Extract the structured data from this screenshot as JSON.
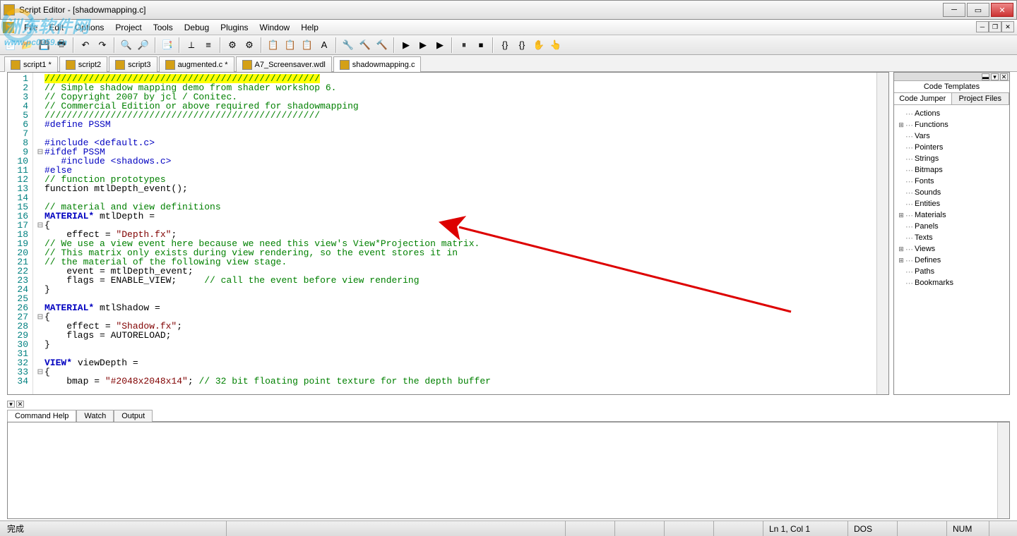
{
  "window": {
    "title": "Script Editor - [shadowmapping.c]"
  },
  "menu": [
    "File",
    "Edit",
    "Options",
    "Project",
    "Tools",
    "Debug",
    "Plugins",
    "Window",
    "Help"
  ],
  "tabs": [
    {
      "label": "script1 *"
    },
    {
      "label": "script2"
    },
    {
      "label": "script3"
    },
    {
      "label": "augmented.c *"
    },
    {
      "label": "A7_Screensaver.wdl"
    },
    {
      "label": "shadowmapping.c",
      "active": true
    }
  ],
  "code": [
    {
      "n": 1,
      "fold": "",
      "cls": "hl-yellow c-comment",
      "text": "//////////////////////////////////////////////////"
    },
    {
      "n": 2,
      "fold": "",
      "cls": "c-comment",
      "text": "// Simple shadow mapping demo from shader workshop 6."
    },
    {
      "n": 3,
      "fold": "",
      "cls": "c-comment",
      "text": "// Copyright 2007 by jcl / Conitec."
    },
    {
      "n": 4,
      "fold": "",
      "cls": "c-comment",
      "text": "// Commercial Edition or above required for shadowmapping"
    },
    {
      "n": 5,
      "fold": "",
      "cls": "c-comment",
      "text": "//////////////////////////////////////////////////"
    },
    {
      "n": 6,
      "fold": "",
      "cls": "c-preproc",
      "text": "#define PSSM"
    },
    {
      "n": 7,
      "fold": "",
      "cls": "",
      "text": ""
    },
    {
      "n": 8,
      "fold": "",
      "cls": "c-preproc",
      "text": "#include <default.c>"
    },
    {
      "n": 9,
      "fold": "⊟",
      "cls": "c-preproc",
      "text": "#ifdef PSSM"
    },
    {
      "n": 10,
      "fold": "",
      "cls": "c-preproc",
      "text": "   #include <shadows.c>"
    },
    {
      "n": 11,
      "fold": "",
      "cls": "c-preproc",
      "text": "#else"
    },
    {
      "n": 12,
      "fold": "",
      "cls": "c-comment",
      "text": "// function prototypes"
    },
    {
      "n": 13,
      "fold": "",
      "cls": "c-ident",
      "text": "function mtlDepth_event();"
    },
    {
      "n": 14,
      "fold": "",
      "cls": "",
      "text": ""
    },
    {
      "n": 15,
      "fold": "",
      "cls": "c-comment",
      "text": "// material and view definitions"
    },
    {
      "n": 16,
      "fold": "",
      "cls": "c-ident",
      "html": "<span class='c-keyword'>MATERIAL*</span> mtlDepth ="
    },
    {
      "n": 17,
      "fold": "⊟",
      "cls": "c-ident",
      "text": "{"
    },
    {
      "n": 18,
      "fold": "",
      "cls": "c-ident",
      "html": "    effect = <span class='c-string'>\"Depth.fx\"</span>;"
    },
    {
      "n": 19,
      "fold": "",
      "cls": "c-comment",
      "text": "// We use a view event here because we need this view's View*Projection matrix."
    },
    {
      "n": 20,
      "fold": "",
      "cls": "c-comment",
      "text": "// This matrix only exists during view rendering, so the event stores it in"
    },
    {
      "n": 21,
      "fold": "",
      "cls": "c-comment",
      "text": "// the material of the following view stage."
    },
    {
      "n": 22,
      "fold": "",
      "cls": "c-ident",
      "text": "    event = mtlDepth_event;"
    },
    {
      "n": 23,
      "fold": "",
      "cls": "c-ident",
      "html": "    flags = ENABLE_VIEW;     <span class='c-comment'>// call the event before view rendering</span>"
    },
    {
      "n": 24,
      "fold": "",
      "cls": "c-ident",
      "text": "}"
    },
    {
      "n": 25,
      "fold": "",
      "cls": "",
      "text": ""
    },
    {
      "n": 26,
      "fold": "",
      "cls": "c-ident",
      "html": "<span class='c-keyword'>MATERIAL*</span> mtlShadow ="
    },
    {
      "n": 27,
      "fold": "⊟",
      "cls": "c-ident",
      "text": "{"
    },
    {
      "n": 28,
      "fold": "",
      "cls": "c-ident",
      "html": "    effect = <span class='c-string'>\"Shadow.fx\"</span>;"
    },
    {
      "n": 29,
      "fold": "",
      "cls": "c-ident",
      "text": "    flags = AUTORELOAD;"
    },
    {
      "n": 30,
      "fold": "",
      "cls": "c-ident",
      "text": "}"
    },
    {
      "n": 31,
      "fold": "",
      "cls": "",
      "text": ""
    },
    {
      "n": 32,
      "fold": "",
      "cls": "c-ident",
      "html": "<span class='c-keyword'>VIEW*</span> viewDepth ="
    },
    {
      "n": 33,
      "fold": "⊟",
      "cls": "c-ident",
      "text": "{"
    },
    {
      "n": 34,
      "fold": "",
      "cls": "c-ident",
      "html": "    bmap = <span class='c-string'>\"#2048x2048x14\"</span>; <span class='c-comment'>// 32 bit floating point texture for the depth buffer</span>"
    }
  ],
  "sidebar": {
    "tab_top": "Code Templates",
    "tabs_bot": [
      "Code Jumper",
      "Project Files"
    ],
    "tree": [
      {
        "exp": "",
        "label": "Actions"
      },
      {
        "exp": "+",
        "label": "Functions"
      },
      {
        "exp": "",
        "label": "Vars"
      },
      {
        "exp": "",
        "label": "Pointers"
      },
      {
        "exp": "",
        "label": "Strings"
      },
      {
        "exp": "",
        "label": "Bitmaps"
      },
      {
        "exp": "",
        "label": "Fonts"
      },
      {
        "exp": "",
        "label": "Sounds"
      },
      {
        "exp": "",
        "label": "Entities"
      },
      {
        "exp": "+",
        "label": "Materials"
      },
      {
        "exp": "",
        "label": "Panels"
      },
      {
        "exp": "",
        "label": "Texts"
      },
      {
        "exp": "+",
        "label": "Views"
      },
      {
        "exp": "+",
        "label": "Defines"
      },
      {
        "exp": "",
        "label": "Paths"
      },
      {
        "exp": "",
        "label": "Bookmarks"
      }
    ]
  },
  "bottom": {
    "tabs": [
      "Command Help",
      "Watch",
      "Output"
    ]
  },
  "status": {
    "ready": "完成",
    "pos": "Ln 1, Col 1",
    "enc": "DOS",
    "num": "NUM"
  },
  "watermark": {
    "main": "洲东软件网",
    "sub": "www.pc0359.cn"
  },
  "tb_icons": [
    "📄",
    "📂",
    "💾",
    "🖶",
    "",
    "↶",
    "↷",
    "",
    "🔍",
    "🔎",
    "",
    "📑",
    "",
    "⟂",
    "≡",
    "",
    "⚙",
    "⚙",
    "",
    "📋",
    "📋",
    "📋",
    "A",
    "",
    "🔧",
    "🔨",
    "🔨",
    "",
    "▶",
    "▶",
    "▶",
    "",
    "⏸",
    "⏹",
    "",
    "{}",
    "{}",
    "✋",
    "👆"
  ]
}
